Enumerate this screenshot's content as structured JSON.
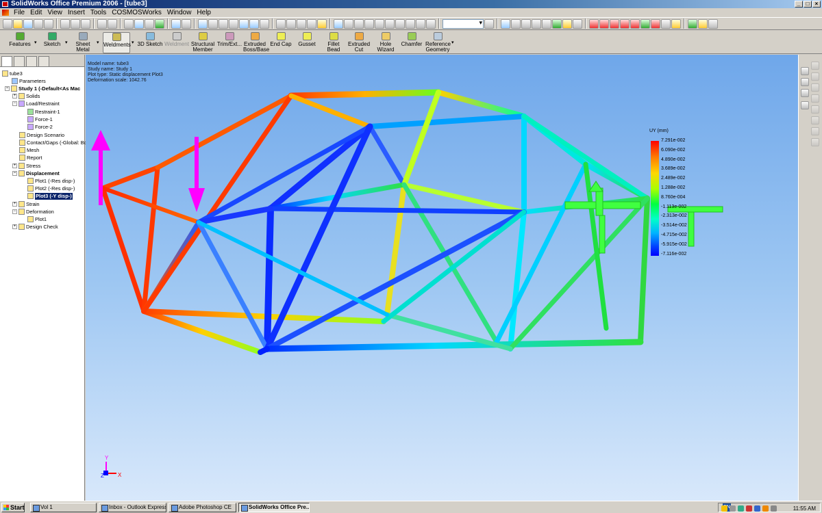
{
  "window": {
    "title": "SolidWorks Office Premium 2006 - [tube3]"
  },
  "menu": [
    "File",
    "Edit",
    "View",
    "Insert",
    "Tools",
    "COSMOSWorks",
    "Window",
    "Help"
  ],
  "command_manager": {
    "features": "Features",
    "sketch": "Sketch",
    "sheet_metal_1": "Sheet",
    "sheet_metal_2": "Metal",
    "weldments": "Weldments",
    "sketch3d": "3D Sketch",
    "weldment": "Weldment",
    "structural_1": "Structural",
    "structural_2": "Member",
    "trim": "Trim/Ext...",
    "extruded_boss_1": "Extruded",
    "extruded_boss_2": "Boss/Base",
    "end_cap": "End Cap",
    "gusset": "Gusset",
    "fillet_bead": "Fillet Bead",
    "extruded_cut_1": "Extruded",
    "extruded_cut_2": "Cut",
    "hole_wizard_1": "Hole",
    "hole_wizard_2": "Wizard",
    "chamfer": "Chamfer",
    "ref_geom_1": "Reference",
    "ref_geom_2": "Geometry"
  },
  "tree": {
    "root": "tube3",
    "parameters": "Parameters",
    "study": "Study 1 (-Default<As Mac",
    "solids": "Solids",
    "load_restraint": "Load/Restraint",
    "restraint1": "Restraint-1",
    "force1": "Force-1",
    "force2": "Force-2",
    "design_scenario": "Design Scenario",
    "contact_gaps": "Contact/Gaps (-Global: Bo",
    "mesh": "Mesh",
    "report": "Report",
    "stress": "Stress",
    "displacement": "Displacement",
    "plot1": "Plot1 (-Res disp-)",
    "plot2": "Plot2 (-Res disp-)",
    "plot3": "Plot3 (-Y disp-)",
    "strain": "Strain",
    "deformation": "Deformation",
    "def_plot1": "Plot1",
    "design_check": "Design Check"
  },
  "study_info": {
    "model": "Model name: tube3",
    "study": "Study name: Study 1",
    "plot_type": "Plot type: Static displacement Plot3",
    "scale": "Deformation scale: 1042.76"
  },
  "legend": {
    "title": "UY (mm)",
    "labels": [
      "7.291e-002",
      "6.090e-002",
      "4.890e-002",
      "3.689e-002",
      "2.489e-002",
      "1.288e-002",
      "8.760e-004",
      "-1.113e-002",
      "-2.313e-002",
      "-3.514e-002",
      "-4.715e-002",
      "-5.915e-002",
      "-7.116e-002"
    ],
    "colors": [
      "#ff0000",
      "#ff7a00",
      "#ffd700",
      "#a8ff00",
      "#00ff40",
      "#00ffc8",
      "#00b4ff",
      "#0040ff",
      "#0000ff"
    ]
  },
  "triad": {
    "x": "X",
    "y": "Y",
    "z": "Z"
  },
  "taskbar": {
    "start": "Start",
    "vol1": "Vol 1",
    "outlook": "Inbox - Outlook Express",
    "photoshop": "Adobe Photoshop CE",
    "solidworks": "SolidWorks Office Pre...",
    "lang": "EN",
    "clock": "11:55 AM"
  }
}
